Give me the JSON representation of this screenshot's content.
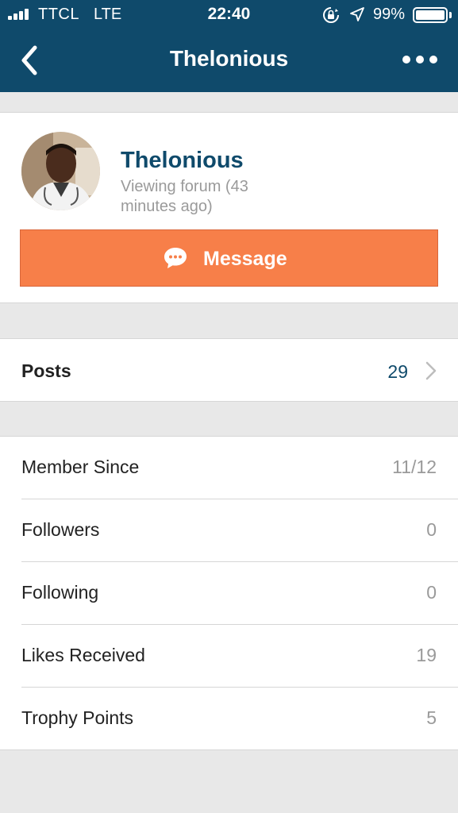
{
  "status_bar": {
    "carrier": "TTCL",
    "network": "LTE",
    "time": "22:40",
    "battery": "99%",
    "battery_level": 0.99
  },
  "nav": {
    "title": "Thelonious",
    "back_icon": "chevron-left-icon",
    "more_icon": "more-horizontal-icon"
  },
  "profile": {
    "username": "Thelonious",
    "activity": "Viewing forum (43 minutes ago)",
    "message_button": "Message",
    "message_icon": "chat-bubble-icon"
  },
  "posts": {
    "label": "Posts",
    "count": "29"
  },
  "stats": [
    {
      "label": "Member Since",
      "value": "11/12"
    },
    {
      "label": "Followers",
      "value": "0"
    },
    {
      "label": "Following",
      "value": "0"
    },
    {
      "label": "Likes Received",
      "value": "19"
    },
    {
      "label": "Trophy Points",
      "value": "5"
    }
  ],
  "colors": {
    "header": "#0f4a6b",
    "accent": "#f77f49",
    "link": "#0f4a6b",
    "muted": "#9a9a9a",
    "background": "#e8e8e8"
  }
}
